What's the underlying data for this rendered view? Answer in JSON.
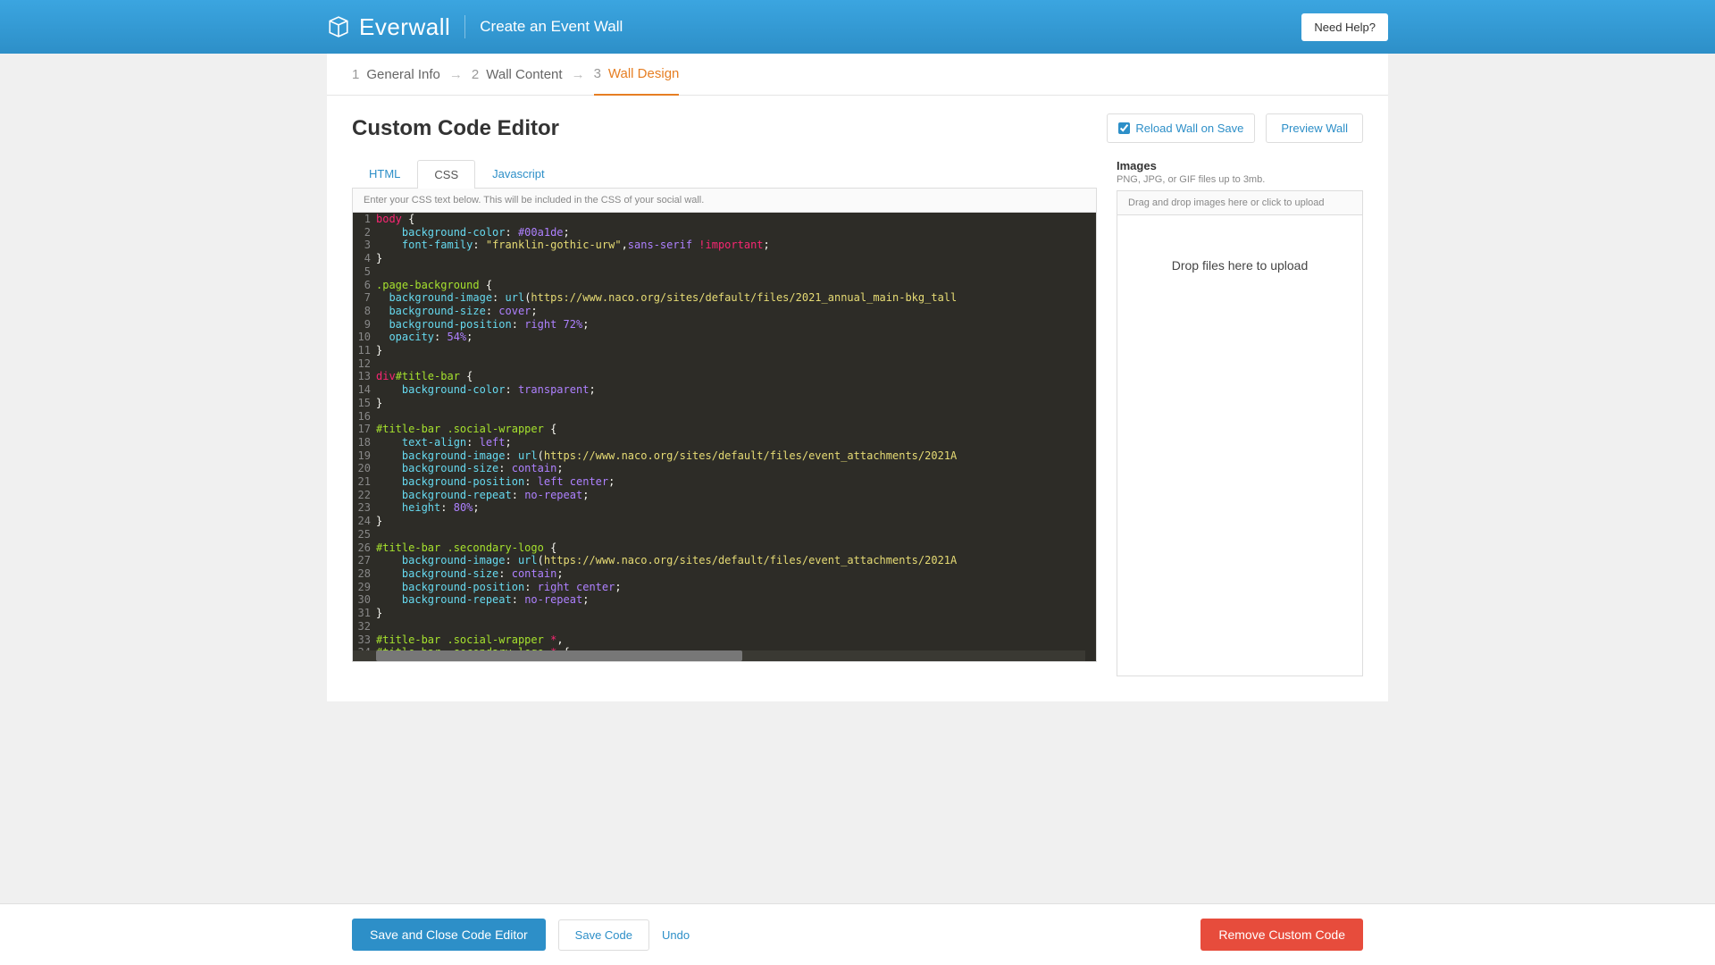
{
  "header": {
    "brand": "Everwall",
    "subtitle": "Create an Event Wall",
    "help_label": "Need Help?"
  },
  "breadcrumb": {
    "steps": [
      {
        "num": "1",
        "label": "General Info"
      },
      {
        "num": "2",
        "label": "Wall Content"
      },
      {
        "num": "3",
        "label": "Wall Design"
      }
    ],
    "active_index": 2
  },
  "page": {
    "title": "Custom Code Editor",
    "reload_label": "Reload Wall on Save",
    "reload_checked": true,
    "preview_label": "Preview Wall"
  },
  "tabs": {
    "items": [
      "HTML",
      "CSS",
      "Javascript"
    ],
    "active_index": 1,
    "hint": "Enter your CSS text below. This will be included in the CSS of your social wall."
  },
  "code_lines": [
    [
      [
        "sel",
        "body"
      ],
      [
        "pn",
        " "
      ],
      [
        "brace",
        "{"
      ]
    ],
    [
      [
        "pn",
        "    "
      ],
      [
        "prop",
        "background-color"
      ],
      [
        "pn",
        ": "
      ],
      [
        "val",
        "#00a1de"
      ],
      [
        "pn",
        ";"
      ]
    ],
    [
      [
        "pn",
        "    "
      ],
      [
        "prop",
        "font-family"
      ],
      [
        "pn",
        ": "
      ],
      [
        "str",
        "\"franklin-gothic-urw\""
      ],
      [
        "pn",
        ","
      ],
      [
        "val",
        "sans-serif"
      ],
      [
        "pn",
        " "
      ],
      [
        "imp",
        "!important"
      ],
      [
        "pn",
        ";"
      ]
    ],
    [
      [
        "brace",
        "}"
      ]
    ],
    [],
    [
      [
        "cls",
        ".page-background"
      ],
      [
        "pn",
        " "
      ],
      [
        "brace",
        "{"
      ]
    ],
    [
      [
        "pn",
        "  "
      ],
      [
        "prop",
        "background-image"
      ],
      [
        "pn",
        ": "
      ],
      [
        "fn",
        "url"
      ],
      [
        "pn",
        "("
      ],
      [
        "url",
        "https://www.naco.org/sites/default/files/2021_annual_main-bkg_tall"
      ]
    ],
    [
      [
        "pn",
        "  "
      ],
      [
        "prop",
        "background-size"
      ],
      [
        "pn",
        ": "
      ],
      [
        "val",
        "cover"
      ],
      [
        "pn",
        ";"
      ]
    ],
    [
      [
        "pn",
        "  "
      ],
      [
        "prop",
        "background-position"
      ],
      [
        "pn",
        ": "
      ],
      [
        "val",
        "right"
      ],
      [
        "pn",
        " "
      ],
      [
        "num",
        "72%"
      ],
      [
        "pn",
        ";"
      ]
    ],
    [
      [
        "pn",
        "  "
      ],
      [
        "prop",
        "opacity"
      ],
      [
        "pn",
        ": "
      ],
      [
        "num",
        "54%"
      ],
      [
        "pn",
        ";"
      ]
    ],
    [
      [
        "brace",
        "}"
      ]
    ],
    [],
    [
      [
        "tag",
        "div"
      ],
      [
        "id",
        "#title-bar"
      ],
      [
        "pn",
        " "
      ],
      [
        "brace",
        "{"
      ]
    ],
    [
      [
        "pn",
        "    "
      ],
      [
        "prop",
        "background-color"
      ],
      [
        "pn",
        ": "
      ],
      [
        "val",
        "transparent"
      ],
      [
        "pn",
        ";"
      ]
    ],
    [
      [
        "brace",
        "}"
      ]
    ],
    [],
    [
      [
        "id",
        "#title-bar"
      ],
      [
        "pn",
        " "
      ],
      [
        "cls",
        ".social-wrapper"
      ],
      [
        "pn",
        " "
      ],
      [
        "brace",
        "{"
      ]
    ],
    [
      [
        "pn",
        "    "
      ],
      [
        "prop",
        "text-align"
      ],
      [
        "pn",
        ": "
      ],
      [
        "val",
        "left"
      ],
      [
        "pn",
        ";"
      ]
    ],
    [
      [
        "pn",
        "    "
      ],
      [
        "prop",
        "background-image"
      ],
      [
        "pn",
        ": "
      ],
      [
        "fn",
        "url"
      ],
      [
        "pn",
        "("
      ],
      [
        "url",
        "https://www.naco.org/sites/default/files/event_attachments/2021A"
      ]
    ],
    [
      [
        "pn",
        "    "
      ],
      [
        "prop",
        "background-size"
      ],
      [
        "pn",
        ": "
      ],
      [
        "val",
        "contain"
      ],
      [
        "pn",
        ";"
      ]
    ],
    [
      [
        "pn",
        "    "
      ],
      [
        "prop",
        "background-position"
      ],
      [
        "pn",
        ": "
      ],
      [
        "val",
        "left center"
      ],
      [
        "pn",
        ";"
      ]
    ],
    [
      [
        "pn",
        "    "
      ],
      [
        "prop",
        "background-repeat"
      ],
      [
        "pn",
        ": "
      ],
      [
        "val",
        "no-repeat"
      ],
      [
        "pn",
        ";"
      ]
    ],
    [
      [
        "pn",
        "    "
      ],
      [
        "prop",
        "height"
      ],
      [
        "pn",
        ": "
      ],
      [
        "num",
        "80%"
      ],
      [
        "pn",
        ";"
      ]
    ],
    [
      [
        "brace",
        "}"
      ]
    ],
    [],
    [
      [
        "id",
        "#title-bar"
      ],
      [
        "pn",
        " "
      ],
      [
        "cls",
        ".secondary-logo"
      ],
      [
        "pn",
        " "
      ],
      [
        "brace",
        "{"
      ]
    ],
    [
      [
        "pn",
        "    "
      ],
      [
        "prop",
        "background-image"
      ],
      [
        "pn",
        ": "
      ],
      [
        "fn",
        "url"
      ],
      [
        "pn",
        "("
      ],
      [
        "url",
        "https://www.naco.org/sites/default/files/event_attachments/2021A"
      ]
    ],
    [
      [
        "pn",
        "    "
      ],
      [
        "prop",
        "background-size"
      ],
      [
        "pn",
        ": "
      ],
      [
        "val",
        "contain"
      ],
      [
        "pn",
        ";"
      ]
    ],
    [
      [
        "pn",
        "    "
      ],
      [
        "prop",
        "background-position"
      ],
      [
        "pn",
        ": "
      ],
      [
        "val",
        "right center"
      ],
      [
        "pn",
        ";"
      ]
    ],
    [
      [
        "pn",
        "    "
      ],
      [
        "prop",
        "background-repeat"
      ],
      [
        "pn",
        ": "
      ],
      [
        "val",
        "no-repeat"
      ],
      [
        "pn",
        ";"
      ]
    ],
    [
      [
        "brace",
        "}"
      ]
    ],
    [],
    [
      [
        "id",
        "#title-bar"
      ],
      [
        "pn",
        " "
      ],
      [
        "cls",
        ".social-wrapper"
      ],
      [
        "pn",
        " "
      ],
      [
        "sel",
        "*"
      ],
      [
        "pn",
        ","
      ]
    ],
    [
      [
        "id",
        "#title-bar"
      ],
      [
        "pn",
        " "
      ],
      [
        "cls",
        ".secondary-logo"
      ],
      [
        "pn",
        " "
      ],
      [
        "sel",
        "*"
      ],
      [
        "pn",
        " "
      ],
      [
        "brace",
        "{"
      ]
    ],
    []
  ],
  "images_panel": {
    "title": "Images",
    "subtitle": "PNG, JPG, or GIF files up to 3mb.",
    "hint": "Drag and drop images here or click to upload",
    "drop_text": "Drop files here to upload"
  },
  "footer": {
    "save_close": "Save and Close Code Editor",
    "save": "Save Code",
    "undo": "Undo",
    "remove": "Remove Custom Code"
  }
}
